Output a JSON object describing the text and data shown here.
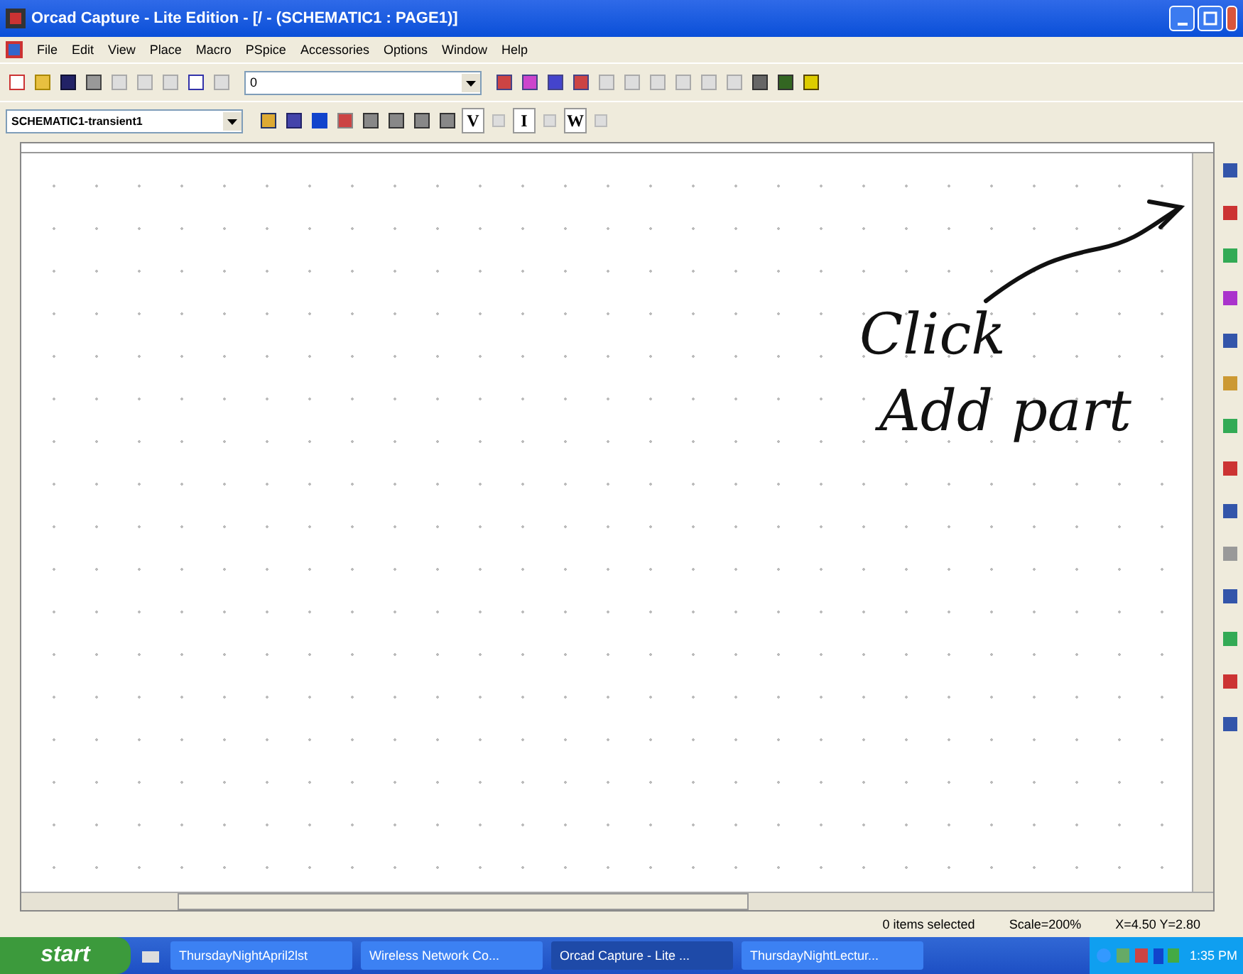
{
  "window": {
    "title": "Orcad Capture - Lite Edition - [/ - (SCHEMATIC1 : PAGE1)]"
  },
  "menu": [
    "File",
    "Edit",
    "View",
    "Place",
    "Macro",
    "PSpice",
    "Accessories",
    "Options",
    "Window",
    "Help"
  ],
  "part_field": {
    "value": "0"
  },
  "profile_field": {
    "value": "SCHEMATIC1-transient1"
  },
  "markers": [
    "V",
    "I",
    "W"
  ],
  "annotation": [
    "Click",
    "Add part"
  ],
  "status_bar": [
    "0 items selected",
    "Scale=200%",
    "X=4.50  Y=2.80"
  ],
  "taskbar": {
    "start": "start",
    "tasks": [
      {
        "label": "ThursdayNightApril2lst",
        "selected": false
      },
      {
        "label": "Wireless Network Co...",
        "selected": false
      },
      {
        "label": "Orcad Capture - Lite ...",
        "selected": true
      },
      {
        "label": "ThursdayNightLectur...",
        "selected": false
      }
    ],
    "clock": "1:35 PM"
  }
}
